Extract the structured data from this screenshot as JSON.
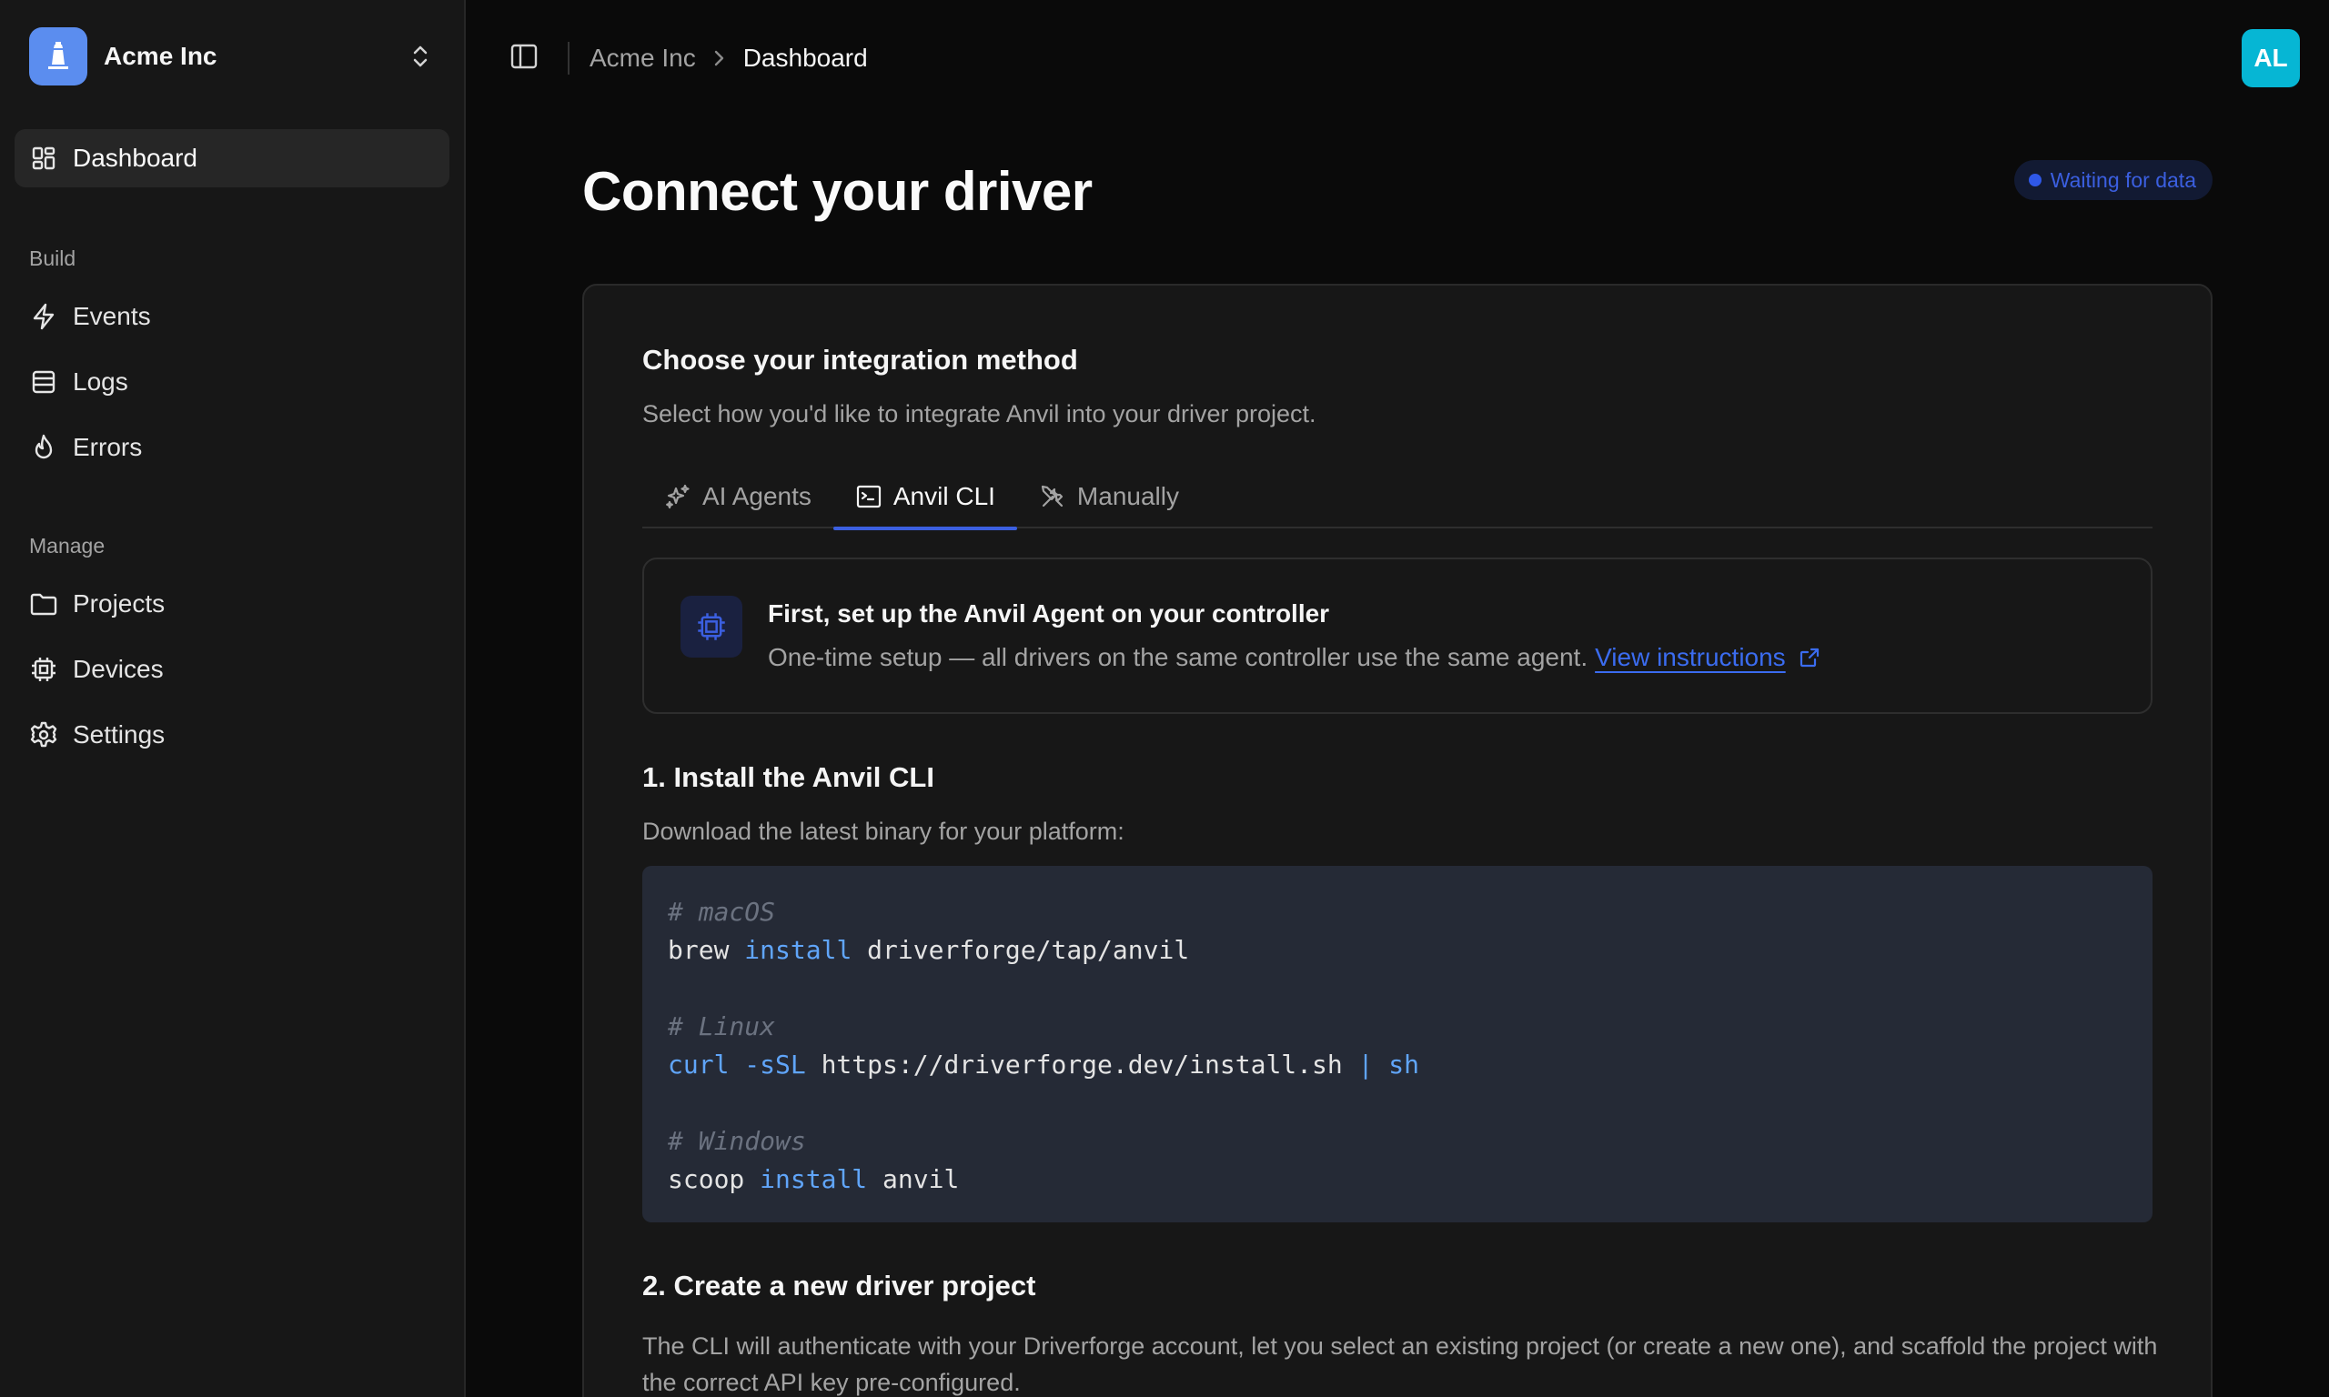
{
  "org": {
    "name": "Acme Inc",
    "logo_icon": "lighthouse-icon"
  },
  "sidebar": {
    "dashboard": "Dashboard",
    "groups": {
      "build": {
        "label": "Build",
        "items": [
          "Events",
          "Logs",
          "Errors"
        ]
      },
      "manage": {
        "label": "Manage",
        "items": [
          "Projects",
          "Devices",
          "Settings"
        ]
      }
    }
  },
  "topbar": {
    "breadcrumb": [
      "Acme Inc",
      "Dashboard"
    ],
    "avatar_initials": "AL"
  },
  "page": {
    "title": "Connect your driver",
    "status": "Waiting for data"
  },
  "card": {
    "title": "Choose your integration method",
    "subtitle": "Select how you'd like to integrate Anvil into your driver project.",
    "tabs": [
      "AI Agents",
      "Anvil CLI",
      "Manually"
    ],
    "active_tab": "Anvil CLI",
    "info": {
      "title": "First, set up the Anvil Agent on your controller",
      "text": "One-time setup — all drivers on the same controller use the same agent.",
      "link": "View instructions"
    },
    "step1": {
      "title": "1. Install the Anvil CLI",
      "desc": "Download the latest binary for your platform:",
      "code": {
        "mac_comment": "# macOS",
        "mac_cmd": "brew",
        "mac_kw": "install",
        "mac_arg": "driverforge/tap/anvil",
        "linux_comment": "# Linux",
        "linux_kw": "curl -sSL",
        "linux_url": "https://driverforge.dev/install.sh",
        "linux_pipe": "| sh",
        "win_comment": "# Windows",
        "win_cmd": "scoop",
        "win_kw": "install",
        "win_arg": "anvil"
      }
    },
    "step2": {
      "title": "2. Create a new driver project",
      "desc": "The CLI will authenticate with your Driverforge account, let you select an existing project (or create a new one), and scaffold the project with the correct API key pre-configured."
    }
  },
  "colors": {
    "accent": "#3b5fe0",
    "avatar": "#06b6d4",
    "org_logo": "#5b8def"
  }
}
